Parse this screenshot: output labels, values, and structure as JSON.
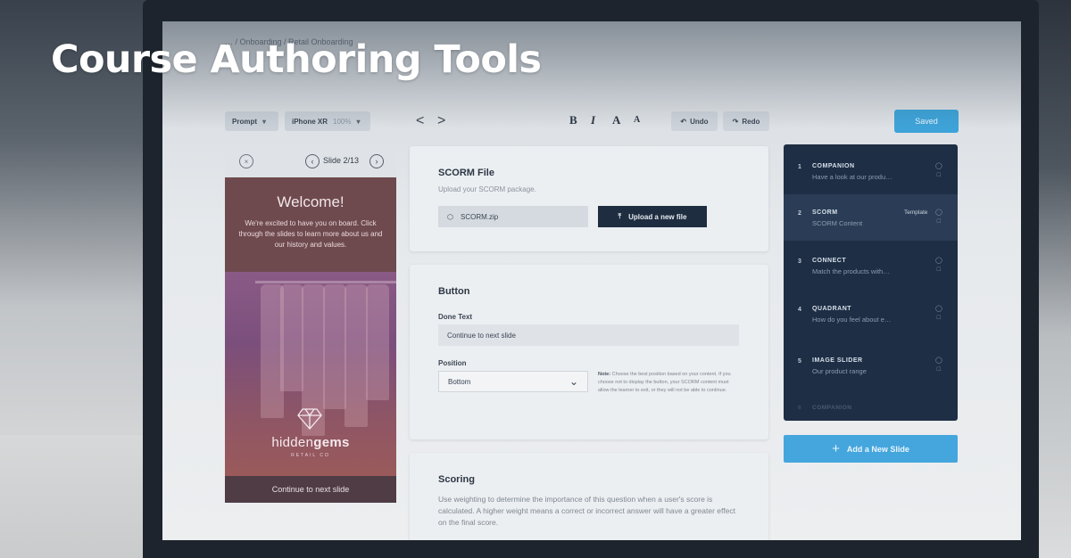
{
  "headline": "Course Authoring Tools",
  "breadcrumb": "…  /  Onboarding  /  Retail Onboarding",
  "toolbar": {
    "prompt_select": "Prompt",
    "device_select": "iPhone XR",
    "device_zoom": "100%",
    "prev_label": "<",
    "next_label": ">",
    "bold": "B",
    "italic": "I",
    "font_larger": "A",
    "font_smaller": "A",
    "undo_label": "Undo",
    "redo_label": "Redo",
    "save_label": "Saved"
  },
  "preview": {
    "close": "×",
    "prev": "‹",
    "slide_counter": "Slide 2/13",
    "next": "›",
    "welcome_title": "Welcome!",
    "welcome_body": "We're excited to have you on board. Click through the slides to learn more about us and our history and values.",
    "brand_light": "hidden",
    "brand_bold": "gems",
    "brand_sub": "RETAIL CO",
    "continue_label": "Continue to next slide"
  },
  "scorm": {
    "title": "SCORM File",
    "subtitle": "Upload your SCORM package.",
    "file_name": "SCORM.zip",
    "upload_label": "Upload a new file"
  },
  "button_panel": {
    "title": "Button",
    "done_text_label": "Done Text",
    "done_text_value": "Continue to next slide",
    "position_label": "Position",
    "position_value": "Bottom",
    "note_bold": "Note:",
    "note_text": "Choose the best position based on your content. If you choose not to display the button, your SCORM content must allow the learner to exit, or they will not be able to continue."
  },
  "scoring": {
    "title": "Scoring",
    "text": "Use weighting to determine the importance of this question when a user's score is calculated. A higher weight means a correct or incorrect answer will have a greater effect on the final score."
  },
  "slides": [
    {
      "num": "1",
      "title": "COMPANION",
      "subtitle": "Have a look at our produ…",
      "tag": ""
    },
    {
      "num": "2",
      "title": "SCORM",
      "subtitle": "SCORM Content",
      "tag": "Template"
    },
    {
      "num": "3",
      "title": "CONNECT",
      "subtitle": "Match the products with…",
      "tag": ""
    },
    {
      "num": "4",
      "title": "QUADRANT",
      "subtitle": "How do you feel about e…",
      "tag": ""
    },
    {
      "num": "5",
      "title": "IMAGE SLIDER",
      "subtitle": "Our product range",
      "tag": ""
    }
  ],
  "slides_faded": {
    "num": "6",
    "title": "COMPANION"
  },
  "add_slide_label": "Add a New Slide",
  "colors": {
    "accent": "#3ea3d8",
    "panel_dark": "#1e2e44",
    "upload_button": "#1f2d40",
    "preview_welcome": "#6e4a4f"
  }
}
